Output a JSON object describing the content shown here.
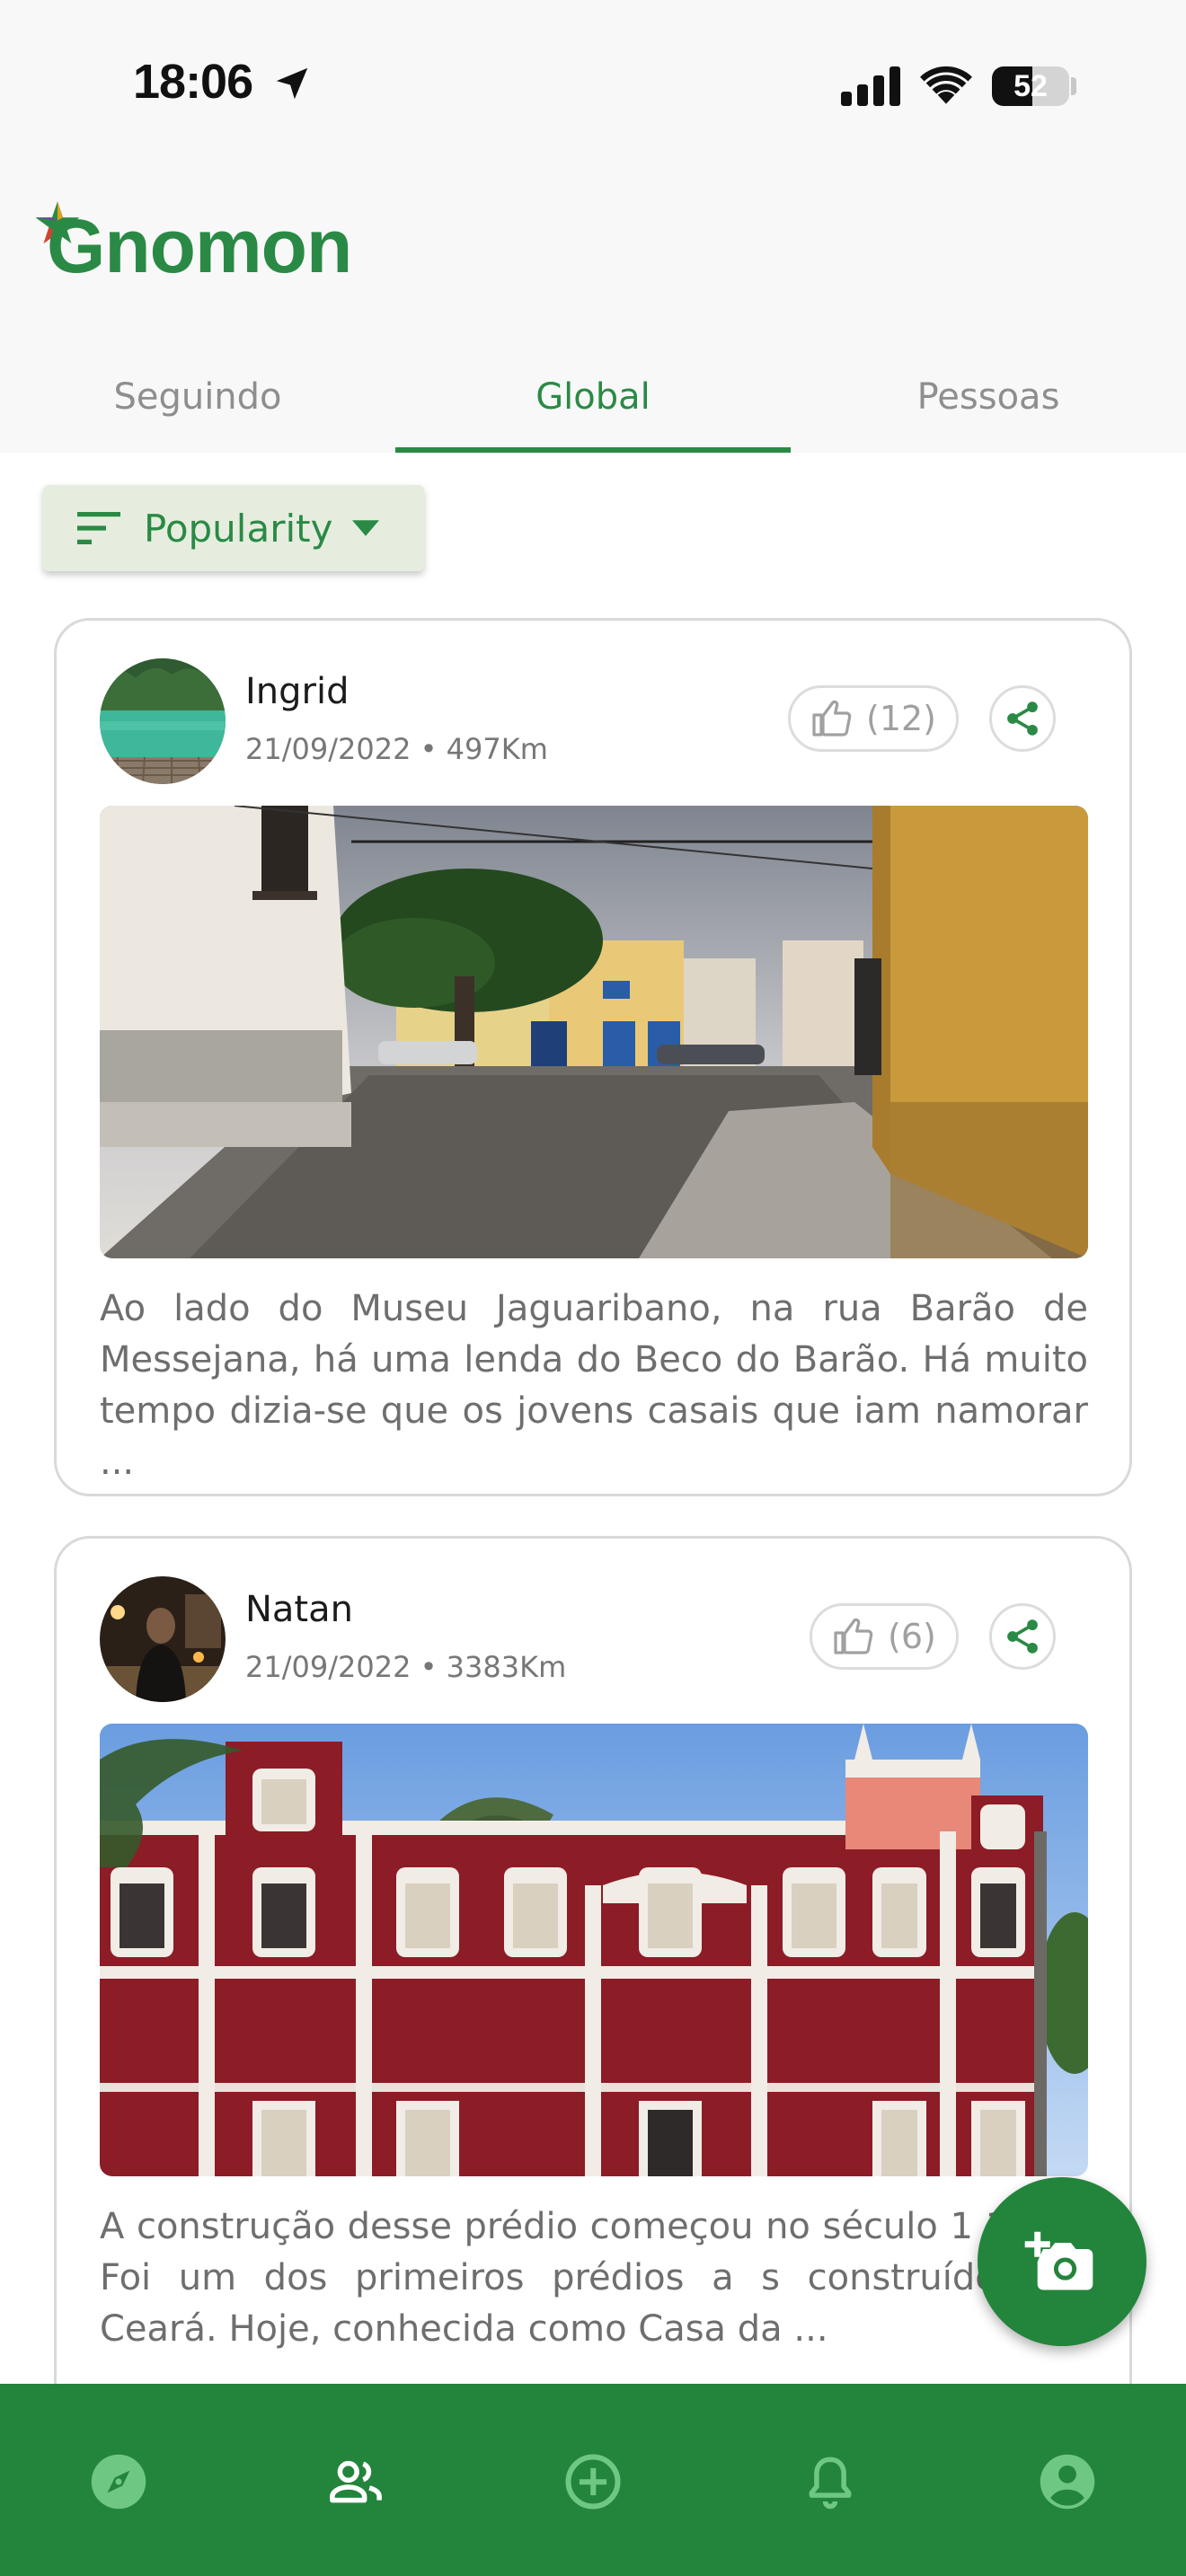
{
  "status_bar": {
    "time": "18:06",
    "battery": "52",
    "battery_level": 0.52
  },
  "app": {
    "title": "Gnomon"
  },
  "tabs": [
    {
      "label": "Seguindo",
      "active": false
    },
    {
      "label": "Global",
      "active": true
    },
    {
      "label": "Pessoas",
      "active": false
    }
  ],
  "sort": {
    "label": "Popularity",
    "icon": "sort-icon"
  },
  "posts": [
    {
      "user": "Ingrid",
      "meta": "21/09/2022 • 497Km",
      "likes": "(12)",
      "text": "Ao lado do Museu Jaguaribano, na rua Barão de Messejana, há uma lenda do Beco do Barão. Há muito tempo dizia-se que os jovens casais que iam namorar ..."
    },
    {
      "user": "Natan",
      "meta": "21/09/2022 • 3383Km",
      "likes": "(6)",
      "text": "A construção desse prédio começou no século 1 1779. Foi um dos primeiros prédios a s construídos no Ceará. Hoje, conhecida como Casa da ..."
    }
  ],
  "bottom_nav": [
    {
      "icon": "compass-icon",
      "active": false
    },
    {
      "icon": "people-icon",
      "active": true
    },
    {
      "icon": "add-circle-icon",
      "active": false
    },
    {
      "icon": "bell-icon",
      "active": false
    },
    {
      "icon": "profile-icon",
      "active": false
    }
  ],
  "colors": {
    "primary": "#2a8a45",
    "nav": "#23843c",
    "nav_inactive": "#6ec783",
    "nav_active": "#ffffff"
  }
}
